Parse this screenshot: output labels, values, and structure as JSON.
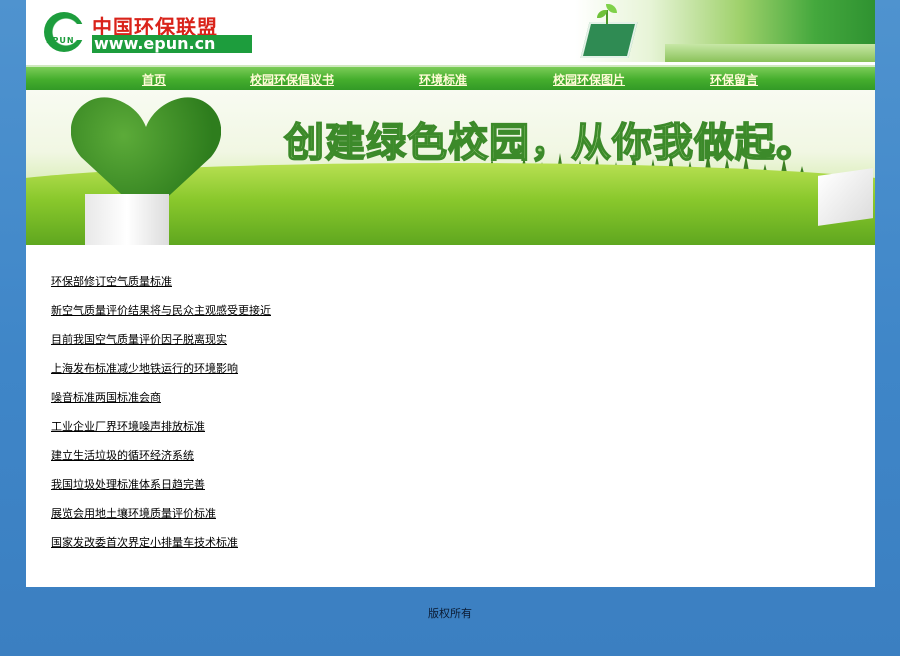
{
  "header": {
    "logo_cn": "中国环保联盟",
    "logo_badge": "EPUN",
    "logo_url": "www.epun.cn"
  },
  "nav": {
    "items": [
      {
        "label": "首页"
      },
      {
        "label": "校园环保倡议书"
      },
      {
        "label": "环境标准"
      },
      {
        "label": "校园环保图片"
      },
      {
        "label": "环保留言"
      }
    ]
  },
  "banner": {
    "slogan": "创建绿色校园，从你我做起。"
  },
  "news": {
    "items": [
      {
        "title": "环保部修订空气质量标准"
      },
      {
        "title": "新空气质量评价结果将与民众主观感受更接近"
      },
      {
        "title": "目前我国空气质量评价因子脱离现实"
      },
      {
        "title": "上海发布标准减少地铁运行的环境影响"
      },
      {
        "title": "噪音标准两国标准会商"
      },
      {
        "title": "工业企业厂界环境噪声排放标准"
      },
      {
        "title": "建立生活垃圾的循环经济系统"
      },
      {
        "title": "我国垃圾处理标准体系日趋完善"
      },
      {
        "title": "展览会用地土壤环境质量评价标准"
      },
      {
        "title": "国家发改委首次界定小排量车技术标准"
      }
    ]
  },
  "footer": {
    "copyright": "版权所有"
  },
  "colors": {
    "nav_green": "#45ae2d",
    "brand_red": "#d9231a",
    "brand_green": "#1d9d3d",
    "background_blue": "#3f86c8"
  }
}
